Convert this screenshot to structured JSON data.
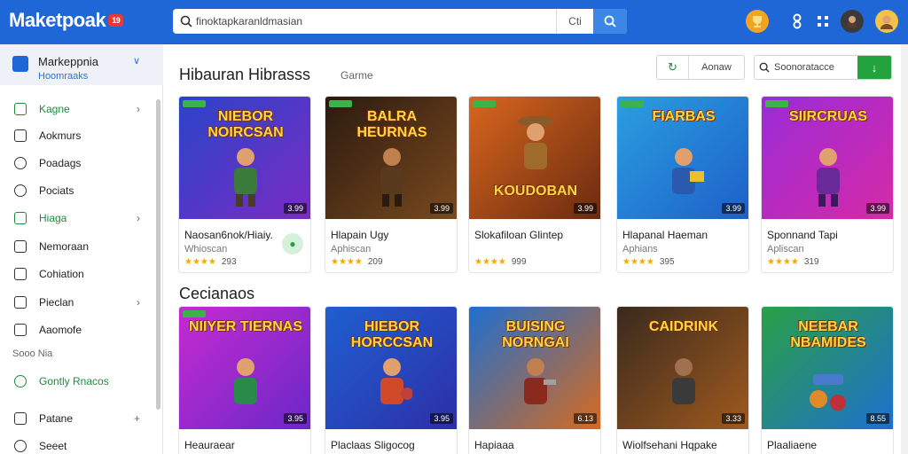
{
  "header": {
    "logo": "Maketpoak",
    "logo_badge": "19",
    "search_value": "finoktapkaranldmasian",
    "search_clear": "Cti",
    "icons": [
      "trophy-icon",
      "grid-icon",
      "apps-icon",
      "notification-icon",
      "avatar"
    ]
  },
  "sidebar": {
    "title": "Markeppnia",
    "subtitle": "Hoomraaks",
    "items": [
      {
        "label": "Kagne",
        "chevron": "›",
        "green": true
      },
      {
        "label": "Aokmurs",
        "chevron": ""
      },
      {
        "label": "Poadags",
        "chevron": ""
      },
      {
        "label": "Pociats",
        "chevron": ""
      },
      {
        "label": "Hiaga",
        "chevron": "›",
        "green": true
      },
      {
        "label": "Nemoraan",
        "chevron": ""
      },
      {
        "label": "Cohiation",
        "chevron": ""
      },
      {
        "label": "Pieclan",
        "chevron": "›"
      },
      {
        "label": "Aaomofe",
        "chevron": ""
      }
    ],
    "section_label": "Sooo Nia",
    "green_link": "Gontly Rnacos",
    "bottom_items": [
      {
        "label": "Patane",
        "chevron": "+"
      },
      {
        "label": "Seeet",
        "chevron": ""
      }
    ]
  },
  "main": {
    "section1_title": "Hibauran Hibrasss",
    "section1_sub": "Garme",
    "filter_label": "Aonaw",
    "mini_search_label": "Soonoratacce",
    "section2_title": "Cecianaos",
    "row1": [
      {
        "art_title": "NIEBOR NOIRCSAN",
        "title": "Naosan6nok/Hiaiy.",
        "publisher": "Whioscan",
        "rating": "293",
        "price": "3.99",
        "colors": [
          "#2a44c8",
          "#7b2bc4"
        ],
        "lock": true
      },
      {
        "art_title": "BALRA HEURNAS",
        "title": "Hlapain Ugy",
        "publisher": "Aphiscan",
        "rating": "209",
        "price": "3.99",
        "colors": [
          "#2b1a10",
          "#7a4a1e"
        ],
        "lock": false
      },
      {
        "art_title": "KOUDOBAN",
        "title": "Slokafiloan Glintep",
        "publisher": "",
        "rating": "999",
        "price": "3.99",
        "colors": [
          "#d8661e",
          "#6a2a10"
        ],
        "lock": false
      },
      {
        "art_title": "FIARBAS",
        "title": "Hlapanal Haeman",
        "publisher": "Aphians",
        "rating": "395",
        "price": "3.99",
        "colors": [
          "#2a9fe0",
          "#1e5fc8"
        ],
        "lock": false
      },
      {
        "art_title": "SIIRCRUAS",
        "title": "Sponnand Tapi",
        "publisher": "Apliscan",
        "rating": "319",
        "price": "3.99",
        "colors": [
          "#9b2bd8",
          "#d62aa6"
        ],
        "lock": false
      }
    ],
    "row2": [
      {
        "art_title": "NIIYER TIERNAS",
        "title": "Heauraear",
        "price": "3.95",
        "colors": [
          "#c62ad0",
          "#6a28c8"
        ]
      },
      {
        "art_title": "HIEBOR HORCCSAN",
        "title": "Placlaas Sligocog",
        "price": "3.95",
        "colors": [
          "#1f5fd0",
          "#2d2fa8"
        ]
      },
      {
        "art_title": "BUISING NORNGAI",
        "title": "Hapiaaa",
        "price": "6.13",
        "colors": [
          "#1e6fd0",
          "#d86a1e"
        ]
      },
      {
        "art_title": "CAIDRINK",
        "title": "Wiolfsehani Hqpake",
        "price": "3.33",
        "colors": [
          "#3a2a1e",
          "#a05a1e"
        ]
      },
      {
        "art_title": "NEEBAR NBAMIDES",
        "title": "Plaaliaene",
        "price": "8.55",
        "colors": [
          "#2aa045",
          "#1e6fd0"
        ]
      }
    ]
  }
}
